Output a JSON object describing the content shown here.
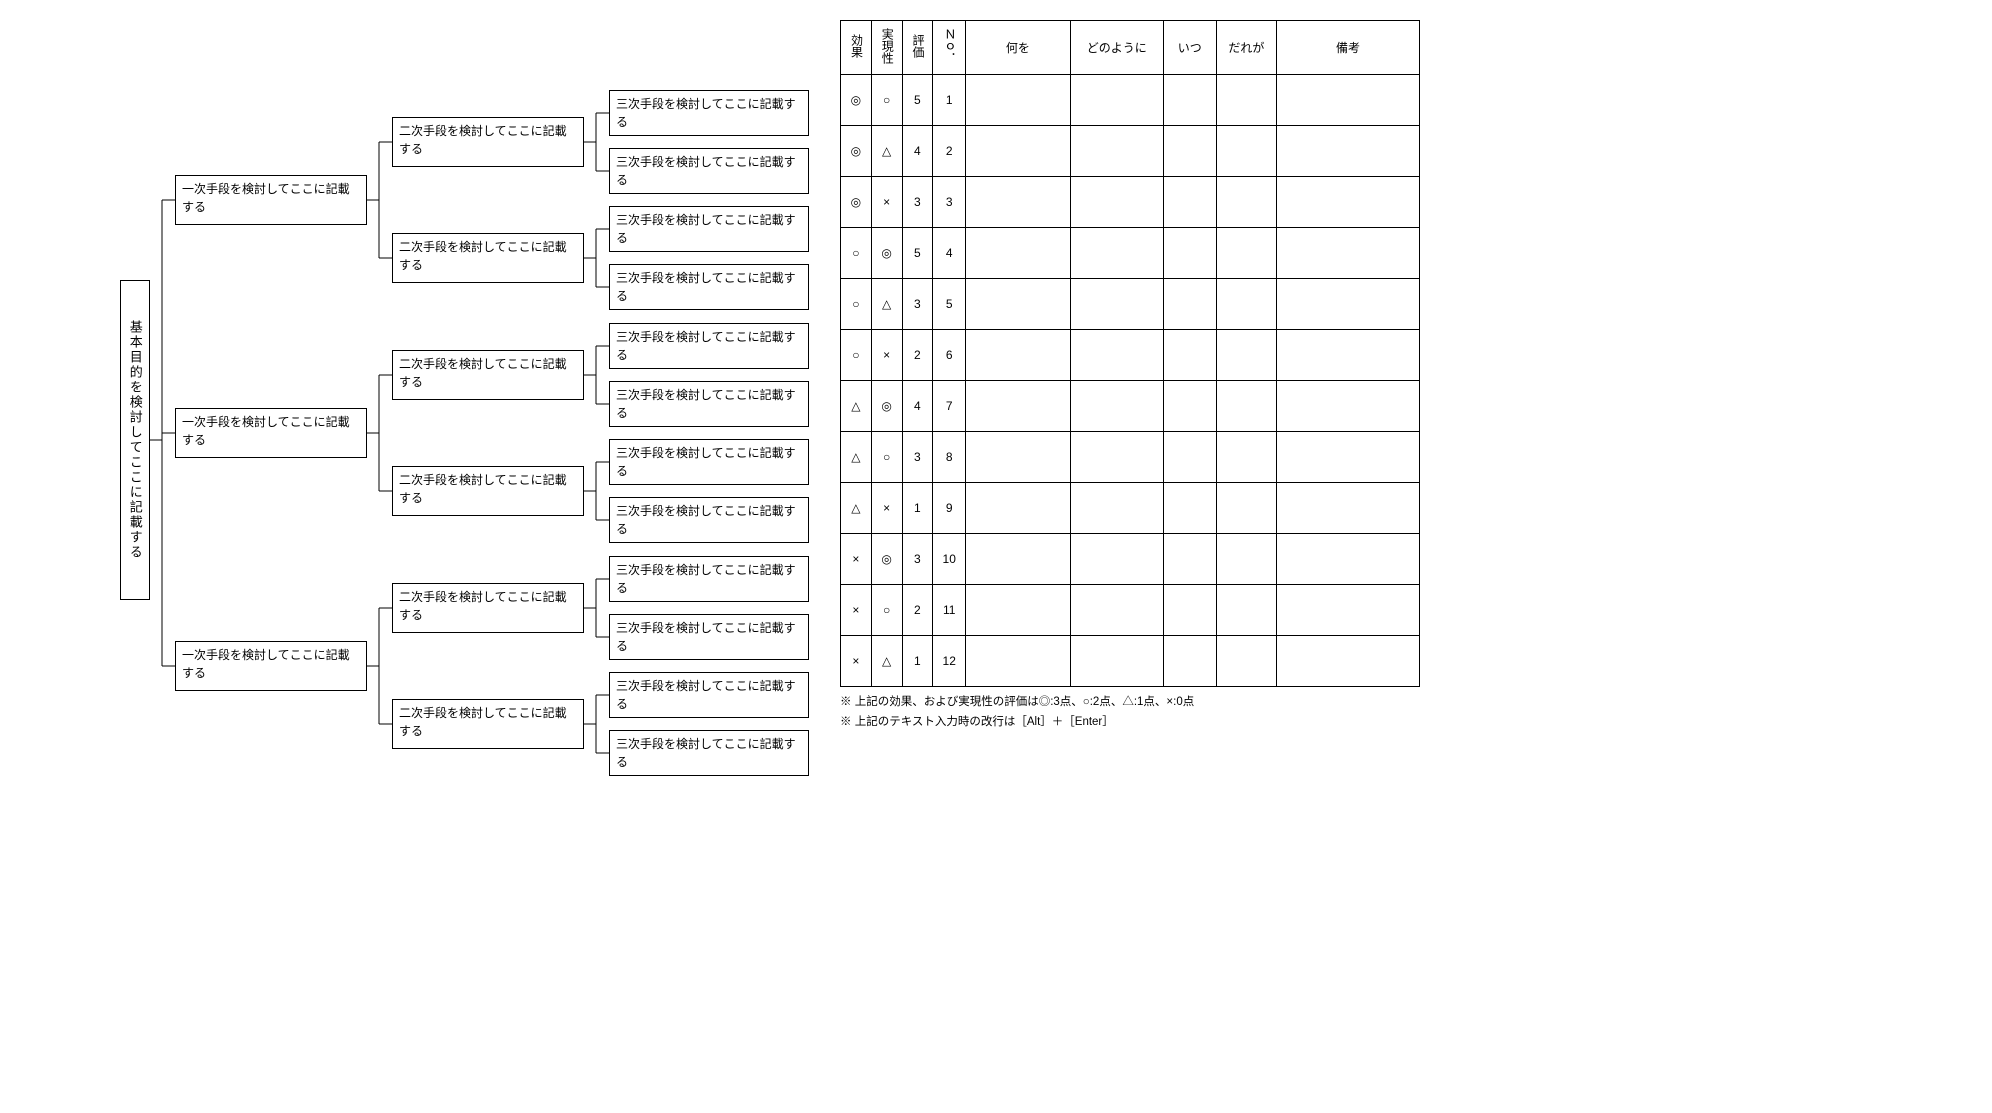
{
  "tree": {
    "root": "基本目的を検討してここに記載する",
    "l1": [
      "一次手段を検討してここに記載する",
      "一次手段を検討してここに記載する",
      "一次手段を検討してここに記載する"
    ],
    "l2": [
      "二次手段を検討してここに記載する",
      "二次手段を検討してここに記載する",
      "二次手段を検討してここに記載する",
      "二次手段を検討してここに記載する",
      "二次手段を検討してここに記載する",
      "二次手段を検討してここに記載する"
    ],
    "l3": [
      "三次手段を検討してここに記載する",
      "三次手段を検討してここに記載する",
      "三次手段を検討してここに記載する",
      "三次手段を検討してここに記載する",
      "三次手段を検討してここに記載する",
      "三次手段を検討してここに記載する",
      "三次手段を検討してここに記載する",
      "三次手段を検討してここに記載する",
      "三次手段を検討してここに記載する",
      "三次手段を検討してここに記載する",
      "三次手段を検討してここに記載する",
      "三次手段を検討してここに記載する"
    ]
  },
  "table": {
    "headers": {
      "effect": "効果",
      "feasibility": "実現性",
      "rating": "評価",
      "no": "Ｎｏ．",
      "what": "何を",
      "how": "どのように",
      "when": "いつ",
      "who": "だれが",
      "remark": "備考"
    },
    "rows": [
      {
        "effect": "◎",
        "feasibility": "○",
        "rating": "5",
        "no": "1",
        "what": "",
        "how": "",
        "when": "",
        "who": "",
        "remark": ""
      },
      {
        "effect": "◎",
        "feasibility": "△",
        "rating": "4",
        "no": "2",
        "what": "",
        "how": "",
        "when": "",
        "who": "",
        "remark": ""
      },
      {
        "effect": "◎",
        "feasibility": "×",
        "rating": "3",
        "no": "3",
        "what": "",
        "how": "",
        "when": "",
        "who": "",
        "remark": ""
      },
      {
        "effect": "○",
        "feasibility": "◎",
        "rating": "5",
        "no": "4",
        "what": "",
        "how": "",
        "when": "",
        "who": "",
        "remark": ""
      },
      {
        "effect": "○",
        "feasibility": "△",
        "rating": "3",
        "no": "5",
        "what": "",
        "how": "",
        "when": "",
        "who": "",
        "remark": ""
      },
      {
        "effect": "○",
        "feasibility": "×",
        "rating": "2",
        "no": "6",
        "what": "",
        "how": "",
        "when": "",
        "who": "",
        "remark": ""
      },
      {
        "effect": "△",
        "feasibility": "◎",
        "rating": "4",
        "no": "7",
        "what": "",
        "how": "",
        "when": "",
        "who": "",
        "remark": ""
      },
      {
        "effect": "△",
        "feasibility": "○",
        "rating": "3",
        "no": "8",
        "what": "",
        "how": "",
        "when": "",
        "who": "",
        "remark": ""
      },
      {
        "effect": "△",
        "feasibility": "×",
        "rating": "1",
        "no": "9",
        "what": "",
        "how": "",
        "when": "",
        "who": "",
        "remark": ""
      },
      {
        "effect": "×",
        "feasibility": "◎",
        "rating": "3",
        "no": "10",
        "what": "",
        "how": "",
        "when": "",
        "who": "",
        "remark": ""
      },
      {
        "effect": "×",
        "feasibility": "○",
        "rating": "2",
        "no": "11",
        "what": "",
        "how": "",
        "when": "",
        "who": "",
        "remark": ""
      },
      {
        "effect": "×",
        "feasibility": "△",
        "rating": "1",
        "no": "12",
        "what": "",
        "how": "",
        "when": "",
        "who": "",
        "remark": ""
      }
    ]
  },
  "notes": {
    "note1": "※ 上記の効果、および実現性の評価は◎:3点、○:2点、△:1点、×:0点",
    "note2": "※ 上記のテキスト入力時の改行は［Alt］＋［Enter］"
  }
}
